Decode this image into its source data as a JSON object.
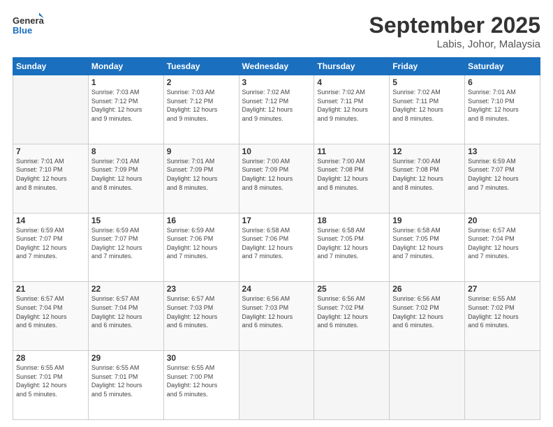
{
  "logo": {
    "line1": "General",
    "line2": "Blue"
  },
  "header": {
    "month": "September 2025",
    "location": "Labis, Johor, Malaysia"
  },
  "weekdays": [
    "Sunday",
    "Monday",
    "Tuesday",
    "Wednesday",
    "Thursday",
    "Friday",
    "Saturday"
  ],
  "weeks": [
    [
      {
        "day": "",
        "info": ""
      },
      {
        "day": "1",
        "info": "Sunrise: 7:03 AM\nSunset: 7:12 PM\nDaylight: 12 hours\nand 9 minutes."
      },
      {
        "day": "2",
        "info": "Sunrise: 7:03 AM\nSunset: 7:12 PM\nDaylight: 12 hours\nand 9 minutes."
      },
      {
        "day": "3",
        "info": "Sunrise: 7:02 AM\nSunset: 7:12 PM\nDaylight: 12 hours\nand 9 minutes."
      },
      {
        "day": "4",
        "info": "Sunrise: 7:02 AM\nSunset: 7:11 PM\nDaylight: 12 hours\nand 9 minutes."
      },
      {
        "day": "5",
        "info": "Sunrise: 7:02 AM\nSunset: 7:11 PM\nDaylight: 12 hours\nand 8 minutes."
      },
      {
        "day": "6",
        "info": "Sunrise: 7:01 AM\nSunset: 7:10 PM\nDaylight: 12 hours\nand 8 minutes."
      }
    ],
    [
      {
        "day": "7",
        "info": "Sunrise: 7:01 AM\nSunset: 7:10 PM\nDaylight: 12 hours\nand 8 minutes."
      },
      {
        "day": "8",
        "info": "Sunrise: 7:01 AM\nSunset: 7:09 PM\nDaylight: 12 hours\nand 8 minutes."
      },
      {
        "day": "9",
        "info": "Sunrise: 7:01 AM\nSunset: 7:09 PM\nDaylight: 12 hours\nand 8 minutes."
      },
      {
        "day": "10",
        "info": "Sunrise: 7:00 AM\nSunset: 7:09 PM\nDaylight: 12 hours\nand 8 minutes."
      },
      {
        "day": "11",
        "info": "Sunrise: 7:00 AM\nSunset: 7:08 PM\nDaylight: 12 hours\nand 8 minutes."
      },
      {
        "day": "12",
        "info": "Sunrise: 7:00 AM\nSunset: 7:08 PM\nDaylight: 12 hours\nand 8 minutes."
      },
      {
        "day": "13",
        "info": "Sunrise: 6:59 AM\nSunset: 7:07 PM\nDaylight: 12 hours\nand 7 minutes."
      }
    ],
    [
      {
        "day": "14",
        "info": "Sunrise: 6:59 AM\nSunset: 7:07 PM\nDaylight: 12 hours\nand 7 minutes."
      },
      {
        "day": "15",
        "info": "Sunrise: 6:59 AM\nSunset: 7:07 PM\nDaylight: 12 hours\nand 7 minutes."
      },
      {
        "day": "16",
        "info": "Sunrise: 6:59 AM\nSunset: 7:06 PM\nDaylight: 12 hours\nand 7 minutes."
      },
      {
        "day": "17",
        "info": "Sunrise: 6:58 AM\nSunset: 7:06 PM\nDaylight: 12 hours\nand 7 minutes."
      },
      {
        "day": "18",
        "info": "Sunrise: 6:58 AM\nSunset: 7:05 PM\nDaylight: 12 hours\nand 7 minutes."
      },
      {
        "day": "19",
        "info": "Sunrise: 6:58 AM\nSunset: 7:05 PM\nDaylight: 12 hours\nand 7 minutes."
      },
      {
        "day": "20",
        "info": "Sunrise: 6:57 AM\nSunset: 7:04 PM\nDaylight: 12 hours\nand 7 minutes."
      }
    ],
    [
      {
        "day": "21",
        "info": "Sunrise: 6:57 AM\nSunset: 7:04 PM\nDaylight: 12 hours\nand 6 minutes."
      },
      {
        "day": "22",
        "info": "Sunrise: 6:57 AM\nSunset: 7:04 PM\nDaylight: 12 hours\nand 6 minutes."
      },
      {
        "day": "23",
        "info": "Sunrise: 6:57 AM\nSunset: 7:03 PM\nDaylight: 12 hours\nand 6 minutes."
      },
      {
        "day": "24",
        "info": "Sunrise: 6:56 AM\nSunset: 7:03 PM\nDaylight: 12 hours\nand 6 minutes."
      },
      {
        "day": "25",
        "info": "Sunrise: 6:56 AM\nSunset: 7:02 PM\nDaylight: 12 hours\nand 6 minutes."
      },
      {
        "day": "26",
        "info": "Sunrise: 6:56 AM\nSunset: 7:02 PM\nDaylight: 12 hours\nand 6 minutes."
      },
      {
        "day": "27",
        "info": "Sunrise: 6:55 AM\nSunset: 7:02 PM\nDaylight: 12 hours\nand 6 minutes."
      }
    ],
    [
      {
        "day": "28",
        "info": "Sunrise: 6:55 AM\nSunset: 7:01 PM\nDaylight: 12 hours\nand 5 minutes."
      },
      {
        "day": "29",
        "info": "Sunrise: 6:55 AM\nSunset: 7:01 PM\nDaylight: 12 hours\nand 5 minutes."
      },
      {
        "day": "30",
        "info": "Sunrise: 6:55 AM\nSunset: 7:00 PM\nDaylight: 12 hours\nand 5 minutes."
      },
      {
        "day": "",
        "info": ""
      },
      {
        "day": "",
        "info": ""
      },
      {
        "day": "",
        "info": ""
      },
      {
        "day": "",
        "info": ""
      }
    ]
  ]
}
